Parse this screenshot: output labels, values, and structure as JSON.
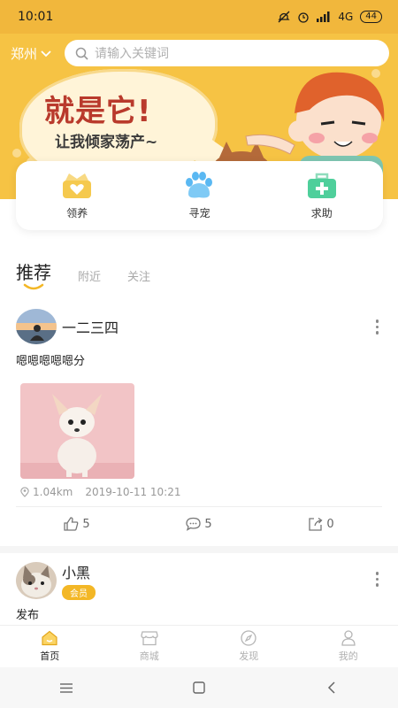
{
  "status_bar": {
    "time": "10:01",
    "network": "4G",
    "battery": "44"
  },
  "header": {
    "city": "郑州",
    "search_placeholder": "请输入关键词"
  },
  "banner": {
    "headline": "就是它!",
    "subline": "让我倾家荡产~"
  },
  "quick_actions": [
    {
      "label": "领养",
      "icon": "adopt-icon",
      "color": "#f5c94e"
    },
    {
      "label": "寻宠",
      "icon": "paw-icon",
      "color": "#5ab8f2"
    },
    {
      "label": "求助",
      "icon": "first-aid-icon",
      "color": "#4fcf9b"
    }
  ],
  "tabs": [
    {
      "label": "推荐",
      "active": true
    },
    {
      "label": "附近",
      "active": false
    },
    {
      "label": "关注",
      "active": false
    }
  ],
  "posts": [
    {
      "username": "一二三四",
      "text": "嗯嗯嗯嗯嗯分",
      "distance": "1.04km",
      "timestamp": "2019-10-11 10:21",
      "likes": "5",
      "comments": "5",
      "shares": "0"
    },
    {
      "username": "小黑",
      "badge": "会员",
      "text": "发布"
    }
  ],
  "bottom_nav": [
    {
      "label": "首页",
      "icon": "home-icon",
      "active": true
    },
    {
      "label": "商城",
      "icon": "shop-icon",
      "active": false
    },
    {
      "label": "发现",
      "icon": "compass-icon",
      "active": false
    },
    {
      "label": "我的",
      "icon": "user-icon",
      "active": false
    }
  ],
  "colors": {
    "accent": "#f3b726",
    "hero": "#f6c344",
    "text": "#222222",
    "muted": "#a9a9a9"
  }
}
